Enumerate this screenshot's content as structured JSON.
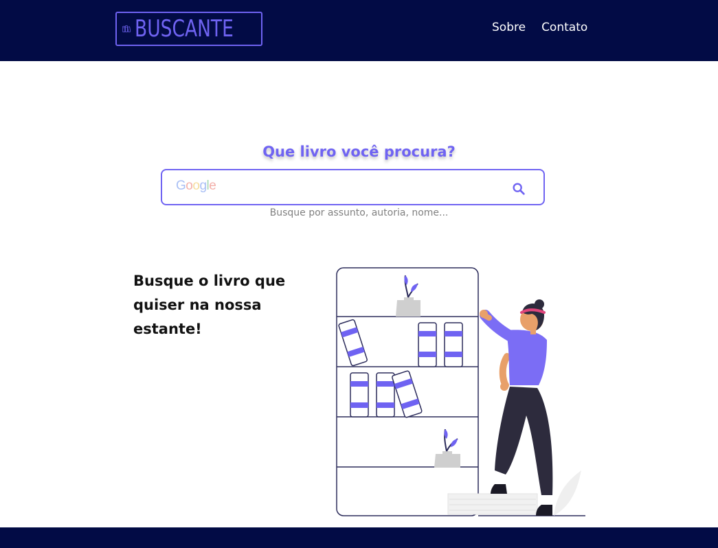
{
  "brand": {
    "logo_text": "BUSCANTE"
  },
  "nav": {
    "items": [
      "Sobre",
      "Contato"
    ]
  },
  "search": {
    "title": "Que livro você procura?",
    "value": "",
    "hint": "Busque por assunto, autoria, nome...",
    "google_mark": "Google"
  },
  "promo": {
    "text": "Busque o livro que quiser na nossa estante!"
  },
  "colors": {
    "header_bg": "#020b45",
    "accent": "#6f63f2",
    "footer_bg": "#020b45"
  },
  "icons": {
    "logo": "books-icon",
    "search": "search-icon"
  }
}
